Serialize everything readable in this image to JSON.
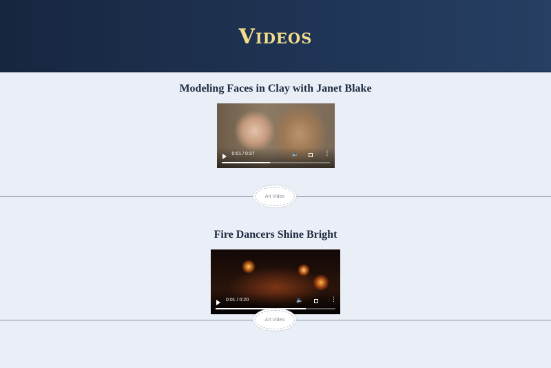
{
  "header": {
    "title": "Videos"
  },
  "videos": [
    {
      "title": "Modeling Faces in Clay with Janet Blake",
      "time": "0:01 / 0:37",
      "progress": 0.45,
      "badge": "Art Video"
    },
    {
      "title": "Fire Dancers Shine Bright",
      "time": "0:01 / 0:20",
      "progress": 0.75,
      "badge": "Art Video"
    }
  ],
  "icons": {
    "play": "play-icon",
    "volume": "volume-icon",
    "fullscreen": "fullscreen-icon",
    "more": "more-vertical-icon"
  },
  "colors": {
    "header_gradient_start": "#17263f",
    "header_gradient_end": "#263f62",
    "title_gold": "#f3dc8c",
    "page_background": "#e9eef7",
    "heading_text": "#1e2b40"
  }
}
